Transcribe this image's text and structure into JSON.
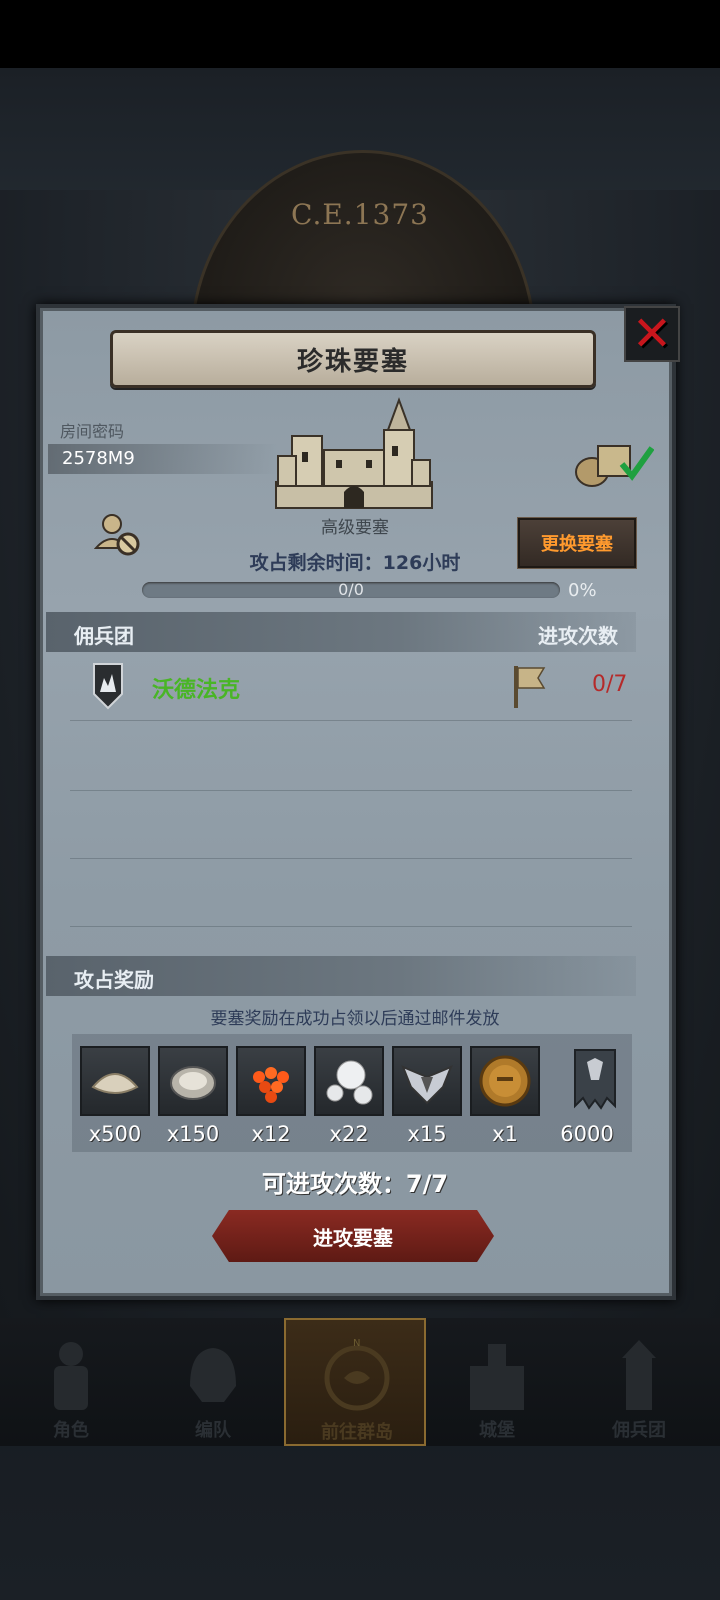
{
  "background": {
    "era_label": "C.E.1373"
  },
  "dialog": {
    "title": "珍珠要塞",
    "room": {
      "label": "房间密码",
      "code": "2578M9"
    },
    "fort_level": "高级要塞",
    "change_button": "更换要塞",
    "occupation_time": "攻占剩余时间：126小时",
    "progress": {
      "text": "0/0",
      "percent_label": "0%",
      "fraction": 0.0
    },
    "mercenary_section": {
      "left_label": "佣兵团",
      "right_label": "进攻次数"
    },
    "mercenary_rows": [
      {
        "name": "沃德法克",
        "attacks": "0/7"
      }
    ],
    "rewards_section": {
      "label": "攻占奖励",
      "note": "要塞奖励在成功占领以后通过邮件发放",
      "items": [
        {
          "icon": "flour-sack-icon",
          "qty": "x500"
        },
        {
          "icon": "oyster-icon",
          "qty": "x150"
        },
        {
          "icon": "fish-roe-icon",
          "qty": "x12"
        },
        {
          "icon": "pearl-icon",
          "qty": "x22"
        },
        {
          "icon": "winged-emblem-icon",
          "qty": "x15"
        },
        {
          "icon": "knight-coin-icon",
          "qty": "x1"
        },
        {
          "icon": "guild-banner-icon",
          "qty": "6000"
        }
      ]
    },
    "attempts_left": "可进攻次数：7/7",
    "attack_button": "进攻要塞"
  },
  "bottom_nav": [
    {
      "label": "角色",
      "icon": "knight-icon",
      "active": false
    },
    {
      "label": "编队",
      "icon": "helmet-icon",
      "active": false
    },
    {
      "label": "前往群岛",
      "icon": "compass-map-icon",
      "active": true
    },
    {
      "label": "城堡",
      "icon": "castle-icon",
      "active": false
    },
    {
      "label": "佣兵团",
      "icon": "tower-icon",
      "active": false
    }
  ],
  "colors": {
    "panel": "#97a3ad",
    "merc_name": "#49b526",
    "attack_count": "#b52a2a",
    "change_button_text": "#ff9a2e",
    "close_x": "#c8161d"
  }
}
